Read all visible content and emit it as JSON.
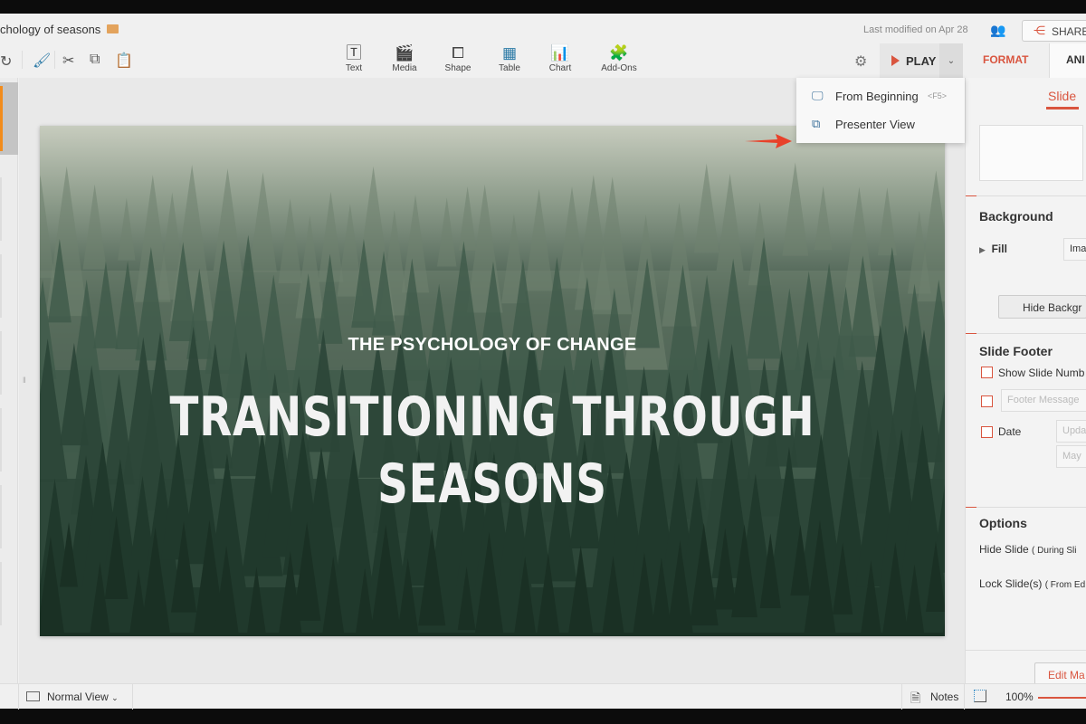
{
  "header": {
    "title": "chology of seasons",
    "last_modified": "Last modified on Apr 28",
    "share_label": "SHARE"
  },
  "toolbar": {
    "tools": [
      {
        "label": "Text",
        "icon": "text-box-icon"
      },
      {
        "label": "Media",
        "icon": "clapperboard-icon"
      },
      {
        "label": "Shape",
        "icon": "shape-icon"
      },
      {
        "label": "Table",
        "icon": "table-icon"
      },
      {
        "label": "Chart",
        "icon": "bar-chart-icon"
      },
      {
        "label": "Add-Ons",
        "icon": "puzzle-icon"
      }
    ],
    "play_label": "PLAY"
  },
  "play_menu": {
    "items": [
      {
        "label": "From Beginning",
        "shortcut": "<F5>"
      },
      {
        "label": "Presenter View"
      }
    ]
  },
  "slide": {
    "subtitle": "THE PSYCHOLOGY OF CHANGE",
    "title_line1": "TRANSITIONING THROUGH",
    "title_line2": "SEASONS"
  },
  "right_panel": {
    "tabs": [
      "FORMAT",
      "ANI"
    ],
    "subtab": "Slide",
    "background": {
      "heading": "Background",
      "fill_label": "Fill",
      "fill_value": "Ima",
      "hide_button": "Hide Backgr"
    },
    "footer": {
      "heading": "Slide Footer",
      "show_slide_number": "Show Slide Numb",
      "footer_placeholder": "Footer Message",
      "date_label": "Date",
      "date_mode": "Upda",
      "date_value": "May"
    },
    "options": {
      "heading": "Options",
      "hide_slide": "Hide Slide",
      "hide_slide_note": "( During Sli",
      "lock_slide": "Lock Slide(s)",
      "lock_slide_note": "( From Ed"
    },
    "edit_master": "Edit Ma"
  },
  "status": {
    "view": "Normal View",
    "notes": "Notes",
    "zoom": "100%"
  },
  "colors": {
    "accent": "#d9553f",
    "thumb_selected": "#f28c1c"
  }
}
